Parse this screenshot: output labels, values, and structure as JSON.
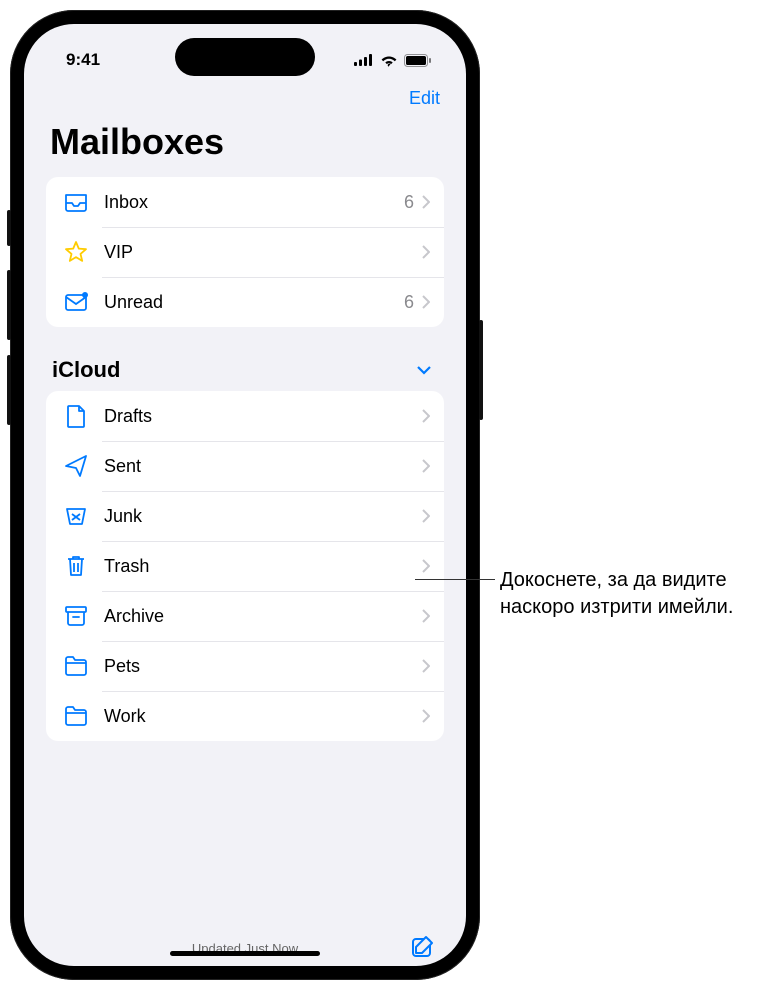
{
  "status": {
    "time": "9:41"
  },
  "nav": {
    "edit": "Edit"
  },
  "title": "Mailboxes",
  "smart": [
    {
      "icon": "inbox",
      "label": "Inbox",
      "count": "6"
    },
    {
      "icon": "star",
      "label": "VIP",
      "count": ""
    },
    {
      "icon": "unread",
      "label": "Unread",
      "count": "6"
    }
  ],
  "section": {
    "label": "iCloud"
  },
  "icloud": [
    {
      "icon": "drafts",
      "label": "Drafts"
    },
    {
      "icon": "sent",
      "label": "Sent"
    },
    {
      "icon": "junk",
      "label": "Junk"
    },
    {
      "icon": "trash",
      "label": "Trash"
    },
    {
      "icon": "archive",
      "label": "Archive"
    },
    {
      "icon": "folder",
      "label": "Pets"
    },
    {
      "icon": "folder",
      "label": "Work"
    }
  ],
  "footer": {
    "status": "Updated Just Now"
  },
  "callout": "Докоснете, за да видите наскоро изтрити имейли."
}
